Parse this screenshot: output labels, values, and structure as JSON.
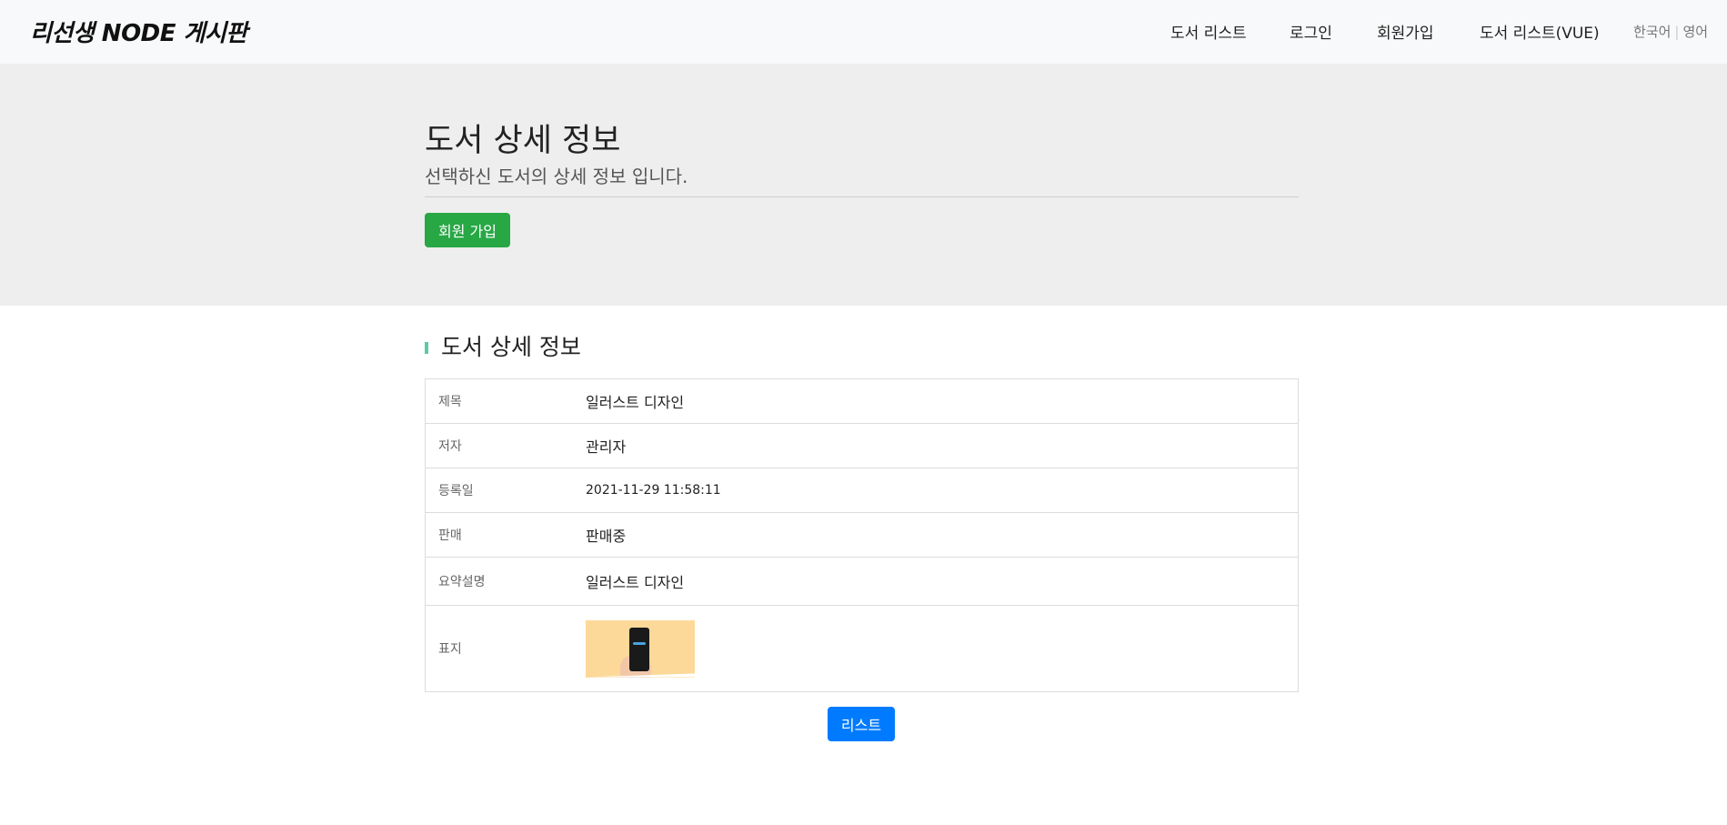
{
  "brand": "리선생 NODE 게시판",
  "nav": {
    "links": [
      "도서 리스트",
      "로그인",
      "회원가입",
      "도서 리스트(VUE)"
    ],
    "lang": [
      "한국어",
      "|",
      "영어"
    ]
  },
  "jumbotron": {
    "title": "도서 상세 정보",
    "subtitle": "선택하신 도서의 상세 정보 입니다.",
    "join_button": "회원 가입"
  },
  "section": {
    "title": "도서 상세 정보"
  },
  "detail": {
    "rows": [
      {
        "label": "제목",
        "value": "일러스트 디자인"
      },
      {
        "label": "저자",
        "value": "관리자"
      },
      {
        "label": "등록일",
        "value": "2021-11-29 11:58:11"
      },
      {
        "label": "판매",
        "value": "판매중"
      },
      {
        "label": "요약설명",
        "value": "일러스트 디자인"
      },
      {
        "label": "표지",
        "value": ""
      }
    ]
  },
  "list_button": "리스트",
  "colors": {
    "navbar_bg": "#f8f9fa",
    "jumbotron_bg": "#eeeeee",
    "success": "#28a745",
    "primary": "#007bff",
    "section_accent": "#5cc9a7"
  }
}
